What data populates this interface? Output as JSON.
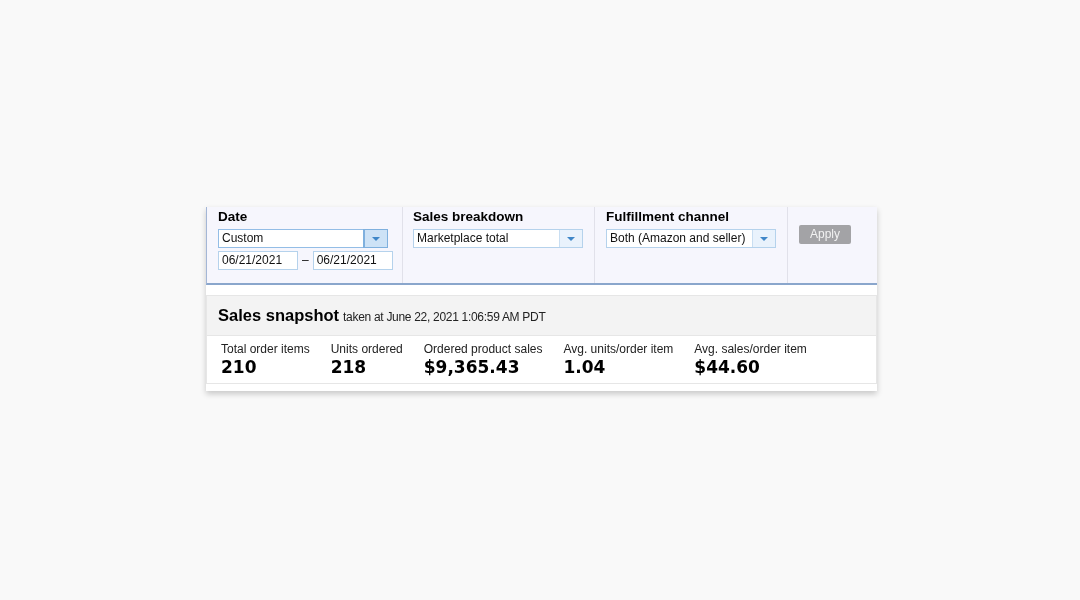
{
  "filters": [
    {
      "kind": "date",
      "label": "Date",
      "select": {
        "value": "Custom",
        "focused": true
      },
      "date_from": "06/21/2021",
      "separator": "–",
      "date_to": "06/21/2021"
    },
    {
      "kind": "select",
      "label": "Sales breakdown",
      "select": {
        "value": "Marketplace total",
        "focused": false
      }
    },
    {
      "kind": "select",
      "label": "Fulfillment channel",
      "select": {
        "value": "Both (Amazon and seller)",
        "focused": false
      }
    }
  ],
  "apply_button": {
    "label": "Apply",
    "disabled": true
  },
  "snapshot": {
    "title": "Sales snapshot",
    "subtitle": "taken at June 22, 2021 1:06:59 AM PDT",
    "metrics": [
      {
        "label": "Total order items",
        "value": "210"
      },
      {
        "label": "Units ordered",
        "value": "218"
      },
      {
        "label": "Ordered product sales",
        "value": "$9,365.43"
      },
      {
        "label": "Avg. units/order item",
        "value": "1.04"
      },
      {
        "label": "Avg. sales/order item",
        "value": "$44.60"
      }
    ]
  }
}
